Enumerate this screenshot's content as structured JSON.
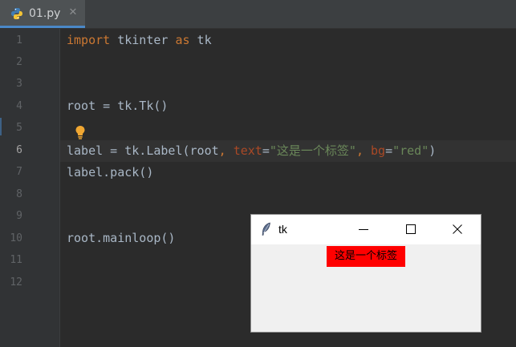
{
  "tab": {
    "filename": "01.py",
    "close_glyph": "✕",
    "icon": "python-file-icon",
    "accent": "#4a88c7"
  },
  "gutter": {
    "line_numbers": [
      "1",
      "2",
      "3",
      "4",
      "5",
      "6",
      "7",
      "8",
      "9",
      "10",
      "11",
      "12"
    ],
    "active_line": "6"
  },
  "code": {
    "line1": {
      "kw1": "import",
      "mod": " tkinter ",
      "kw2": "as",
      "alias": " tk"
    },
    "line4": {
      "text": "root = tk.Tk()"
    },
    "line6": {
      "pre": "label = tk.Label(root",
      "comma1": ", ",
      "param1": "text",
      "eq1": "=",
      "str1": "\"这是一个标签\"",
      "comma2": ", ",
      "param2": "bg",
      "eq2": "=",
      "str2": "\"red\"",
      "close": ")"
    },
    "line7": {
      "text": "label.pack()"
    },
    "line10": {
      "text": "root.mainloop()"
    }
  },
  "intention_icon": "lightbulb-icon",
  "tk_window": {
    "title": "tk",
    "icon": "tk-feather-icon",
    "label_text": "这是一个标签",
    "label_bg": "#ff0000",
    "min_icon": "minimize-icon",
    "max_icon": "maximize-icon",
    "close_icon": "close-icon"
  }
}
